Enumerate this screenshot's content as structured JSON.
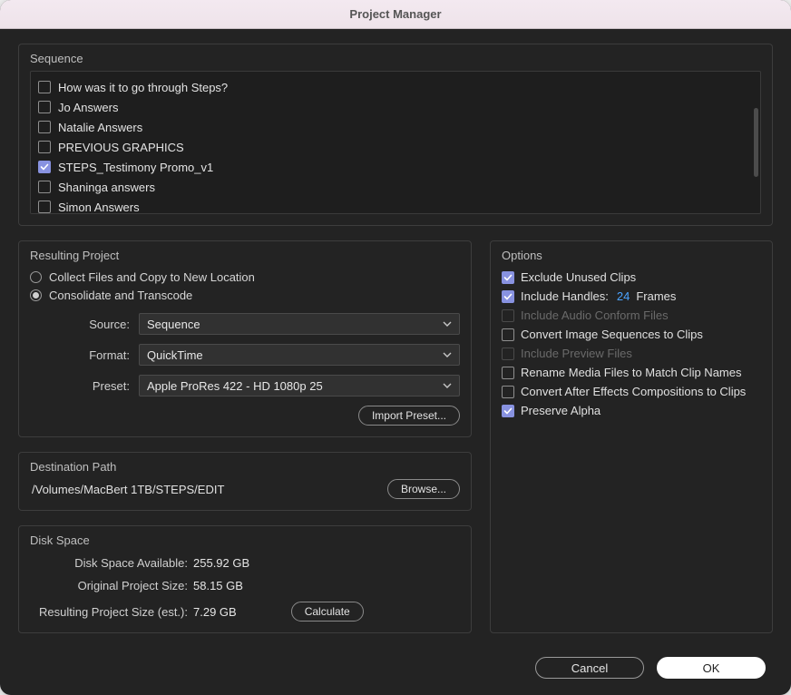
{
  "window": {
    "title": "Project Manager"
  },
  "sequence_section": {
    "title": "Sequence",
    "items": [
      {
        "label": "How was it to go through Steps?",
        "checked": false
      },
      {
        "label": "Jo Answers",
        "checked": false
      },
      {
        "label": "Natalie Answers",
        "checked": false
      },
      {
        "label": "PREVIOUS GRAPHICS",
        "checked": false
      },
      {
        "label": "STEPS_Testimony Promo_v1",
        "checked": true
      },
      {
        "label": "Shaninga answers",
        "checked": false
      },
      {
        "label": "Simon Answers",
        "checked": false
      }
    ]
  },
  "resulting_project": {
    "title": "Resulting Project",
    "radios": {
      "collect": {
        "label": "Collect Files and Copy to New Location",
        "selected": false
      },
      "consolidate": {
        "label": "Consolidate and Transcode",
        "selected": true
      }
    },
    "source": {
      "label": "Source:",
      "value": "Sequence"
    },
    "format": {
      "label": "Format:",
      "value": "QuickTime"
    },
    "preset": {
      "label": "Preset:",
      "value": "Apple ProRes 422 - HD 1080p 25"
    },
    "import_preset": "Import Preset..."
  },
  "destination_path": {
    "title": "Destination Path",
    "path": "/Volumes/MacBert 1TB/STEPS/EDIT",
    "browse": "Browse..."
  },
  "disk_space": {
    "title": "Disk Space",
    "available": {
      "label": "Disk Space Available:",
      "value": "255.92 GB"
    },
    "original": {
      "label": "Original Project Size:",
      "value": "58.15 GB"
    },
    "resulting": {
      "label": "Resulting Project Size (est.):",
      "value": "7.29 GB"
    },
    "calculate": "Calculate"
  },
  "options": {
    "title": "Options",
    "exclude_unused": {
      "label": "Exclude Unused Clips",
      "checked": true,
      "enabled": true
    },
    "include_handles": {
      "label": "Include Handles:",
      "checked": true,
      "enabled": true,
      "count": "24",
      "unit": "Frames"
    },
    "include_audio": {
      "label": "Include Audio Conform Files",
      "checked": false,
      "enabled": false
    },
    "convert_img_seq": {
      "label": "Convert Image Sequences to Clips",
      "checked": false,
      "enabled": true
    },
    "include_preview": {
      "label": "Include Preview Files",
      "checked": false,
      "enabled": false
    },
    "rename_media": {
      "label": "Rename Media Files to Match Clip Names",
      "checked": false,
      "enabled": true
    },
    "convert_ae": {
      "label": "Convert After Effects Compositions to Clips",
      "checked": false,
      "enabled": true
    },
    "preserve_alpha": {
      "label": "Preserve Alpha",
      "checked": true,
      "enabled": true
    }
  },
  "footer": {
    "cancel": "Cancel",
    "ok": "OK"
  }
}
